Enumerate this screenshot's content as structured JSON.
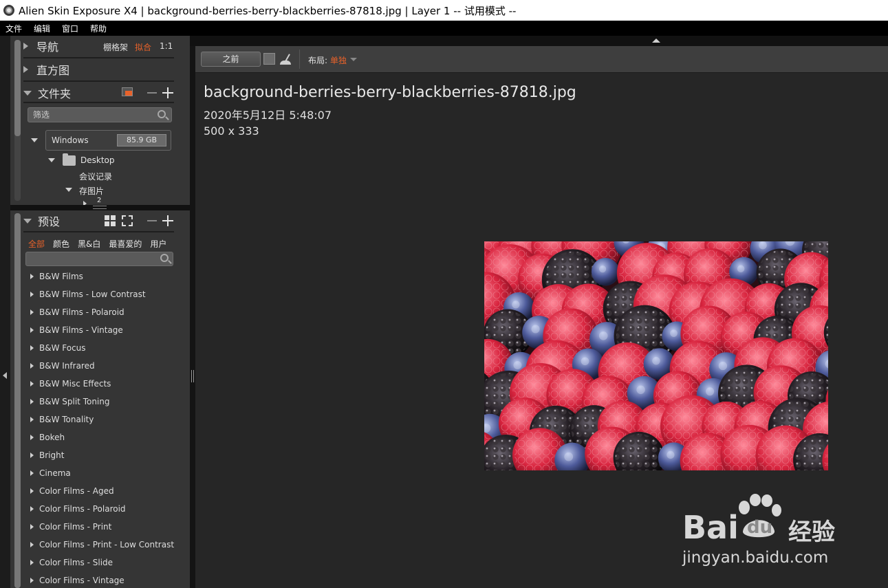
{
  "window": {
    "title": "Alien Skin Exposure X4 | background-berries-berry-blackberries-87818.jpg | Layer 1 -- 试用模式 --"
  },
  "menu": {
    "items": [
      "文件",
      "编辑",
      "窗口",
      "帮助"
    ]
  },
  "navigator": {
    "title": "导航",
    "grid": "棚格架",
    "fit": "拟合",
    "one_to_one": "1:1"
  },
  "histogram": {
    "title": "直方图"
  },
  "folders": {
    "title": "文件夹",
    "filter_placeholder": "筛选",
    "drive": {
      "name": "Windows",
      "size": "85.9 GB"
    },
    "tree": {
      "desktop": "Desktop",
      "meeting": "会议记录",
      "saved_pics": "存图片",
      "sub": "2"
    }
  },
  "presets": {
    "title": "预设",
    "tabs": [
      "全部",
      "颜色",
      "黑&白",
      "最喜爱的",
      "用户"
    ],
    "items": [
      "B&W Films",
      "B&W Films - Low Contrast",
      "B&W Films - Polaroid",
      "B&W Films - Vintage",
      "B&W Focus",
      "B&W Infrared",
      "B&W Misc Effects",
      "B&W Split Toning",
      "B&W Tonality",
      "Bokeh",
      "Bright",
      "Cinema",
      "Color Films - Aged",
      "Color Films - Polaroid",
      "Color Films - Print",
      "Color Films - Print - Low Contrast",
      "Color Films - Slide",
      "Color Films - Vintage"
    ]
  },
  "toolbar": {
    "before": "之前",
    "layout_label": "布局:",
    "layout_value": "单独"
  },
  "image_info": {
    "filename": "background-berries-berry-blackberries-87818.jpg",
    "date": "2020年5月12日 5:48:07",
    "dimensions": "500 x 333"
  },
  "watermark": {
    "brand_left": "Bai",
    "brand_right": "du",
    "brand_cn": "经验",
    "url": "jingyan.baidu.com"
  },
  "colors": {
    "accent": "#e8622a",
    "panel": "#353535",
    "canvas": "#262626"
  }
}
